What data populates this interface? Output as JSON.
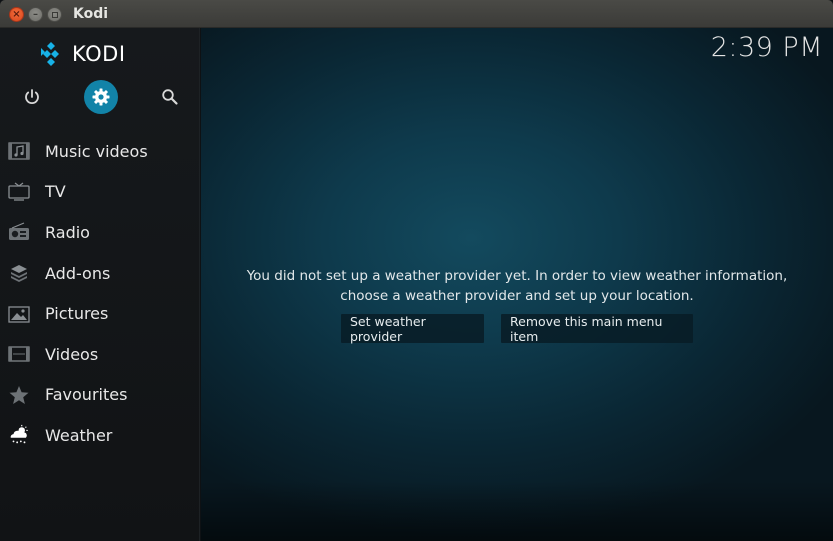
{
  "window": {
    "title": "Kodi"
  },
  "sidebar": {
    "logo_text": "KODI",
    "top_icons": [
      "power-icon",
      "settings-icon",
      "search-icon"
    ],
    "items": [
      {
        "label": "Music videos",
        "icon": "music-video-icon"
      },
      {
        "label": "TV",
        "icon": "tv-icon"
      },
      {
        "label": "Radio",
        "icon": "radio-icon"
      },
      {
        "label": "Add-ons",
        "icon": "addons-icon"
      },
      {
        "label": "Pictures",
        "icon": "pictures-icon"
      },
      {
        "label": "Videos",
        "icon": "videos-icon"
      },
      {
        "label": "Favourites",
        "icon": "star-icon"
      },
      {
        "label": "Weather",
        "icon": "weather-icon"
      }
    ]
  },
  "header": {
    "clock": "2:39 PM"
  },
  "main": {
    "message_line1": "You did not set up a weather provider yet. In order to view weather information,",
    "message_line2": "choose a weather provider and set up your location.",
    "buttons": {
      "set_provider": "Set weather provider",
      "remove_item": "Remove this main menu item"
    }
  },
  "colors": {
    "accent": "#1283a8",
    "sidebar_bg": "#16191c",
    "main_bg": "#0e3a4c",
    "text": "#e8e8e8"
  }
}
